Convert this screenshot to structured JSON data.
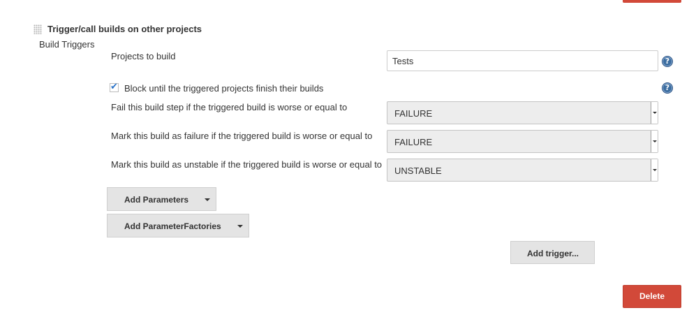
{
  "section": {
    "title": "Trigger/call builds on other projects",
    "subtitle": "Build Triggers"
  },
  "projects": {
    "label": "Projects to build",
    "value": "Tests"
  },
  "block": {
    "label": "Block until the triggered projects finish their builds",
    "checked": true
  },
  "fail_step": {
    "label": "Fail this build step if the triggered build is worse or equal to",
    "value": "FAILURE"
  },
  "mark_failure": {
    "label": "Mark this build as failure if the triggered build is worse or equal to",
    "value": "FAILURE"
  },
  "mark_unstable": {
    "label": "Mark this build as unstable if the triggered build is worse or equal to",
    "value": "UNSTABLE"
  },
  "buttons": {
    "add_parameters": "Add Parameters",
    "add_parameter_factories": "Add ParameterFactories",
    "add_trigger": "Add trigger...",
    "delete": "Delete"
  },
  "help_glyph": "?",
  "colors": {
    "delete": "#d24939",
    "help": "#3c6da0",
    "checkmark": "#2a73c8"
  }
}
